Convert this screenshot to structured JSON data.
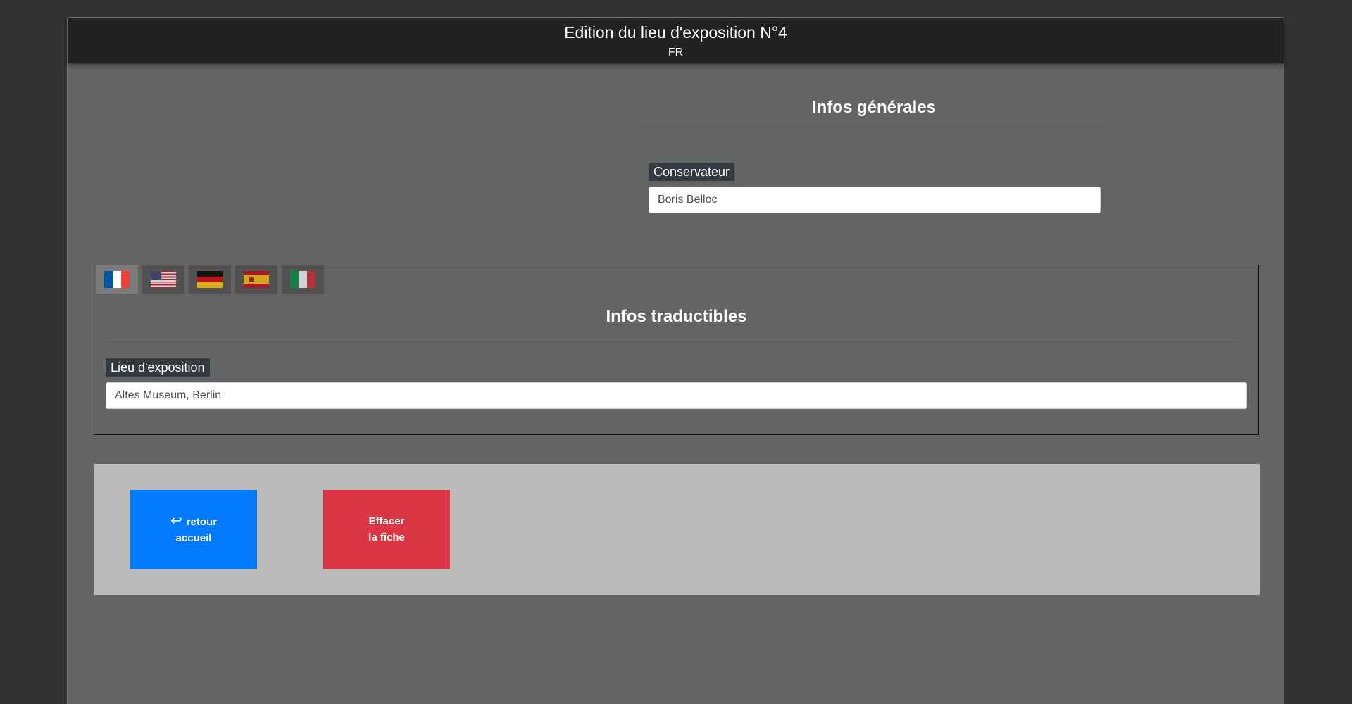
{
  "header": {
    "title": "Edition du lieu d'exposition N°4",
    "lang": "FR"
  },
  "general": {
    "title": "Infos générales",
    "conservateur_label": "Conservateur",
    "conservateur_value": "Boris Belloc"
  },
  "languages": [
    {
      "code": "fr",
      "icon": "flag-france-icon",
      "active": true
    },
    {
      "code": "en",
      "icon": "flag-usa-icon",
      "active": false
    },
    {
      "code": "de",
      "icon": "flag-germany-icon",
      "active": false
    },
    {
      "code": "es",
      "icon": "flag-spain-icon",
      "active": false
    },
    {
      "code": "it",
      "icon": "flag-italy-icon",
      "active": false
    }
  ],
  "translatable": {
    "title": "Infos traductibles",
    "lieu_label": "Lieu d'exposition",
    "lieu_value": "Altes Museum, Berlin"
  },
  "actions": {
    "back_line1": "retour",
    "back_line2": "accueil",
    "delete_line1": "Effacer",
    "delete_line2": "la fiche"
  },
  "colors": {
    "primary": "#007bff",
    "danger": "#dc3545",
    "label_bg": "#343a40",
    "header_bg": "#222222",
    "card_bg": "#646464",
    "action_bar_bg": "#bbbbbb"
  }
}
